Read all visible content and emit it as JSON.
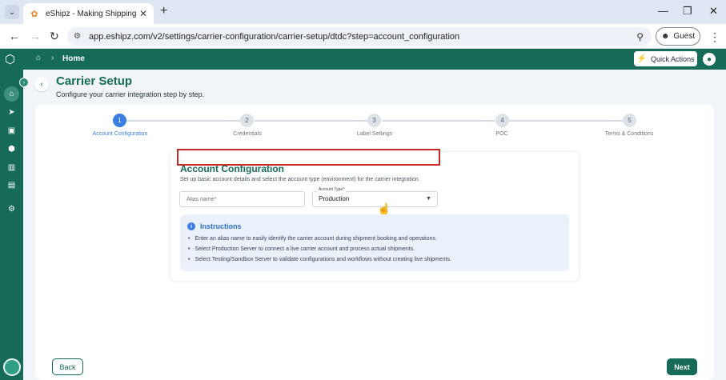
{
  "browser": {
    "tab_title": "eShipz - Making Shipping Easy",
    "url": "app.eshipz.com/v2/settings/carrier-configuration/carrier-setup/dtdc?step=account_configuration",
    "profile_label": "Guest"
  },
  "header": {
    "breadcrumb_home": "Home",
    "quick_actions_label": "Quick Actions"
  },
  "page": {
    "title": "Carrier Setup",
    "subtitle": "Configure your carrier integration step by step."
  },
  "stepper": {
    "steps": [
      {
        "number": "1",
        "label": "Account Configuration"
      },
      {
        "number": "2",
        "label": "Credentials"
      },
      {
        "number": "3",
        "label": "Label Settings"
      },
      {
        "number": "4",
        "label": "POC"
      },
      {
        "number": "5",
        "label": "Terms & Conditions"
      }
    ],
    "active_step": 1
  },
  "form": {
    "section_title": "Account Configuration",
    "section_description": "Set up basic account details and select the account type (environment) for the carrier integration.",
    "alias_placeholder": "Alias name*",
    "account_type_label": "Account Type*",
    "account_type_value": "Production"
  },
  "instructions": {
    "title": "Instructions",
    "items": [
      "Enter an alias name to easily identify the carrier account during shipment booking and operations.",
      "Select Production Server to connect a live carrier account and process actual shipments.",
      "Select Testing/Sandbox Server to validate configurations and workflows without creating live shipments."
    ]
  },
  "footer": {
    "back_label": "Back",
    "next_label": "Next"
  },
  "colors": {
    "brand_green": "#156b58",
    "active_step_blue": "#3b7de0",
    "highlight_red": "#c62828"
  },
  "icons": {
    "sidebar": [
      "home-icon",
      "rocket-icon",
      "shipments-icon",
      "box-icon",
      "reports-icon",
      "document-icon",
      "settings-icon"
    ]
  }
}
